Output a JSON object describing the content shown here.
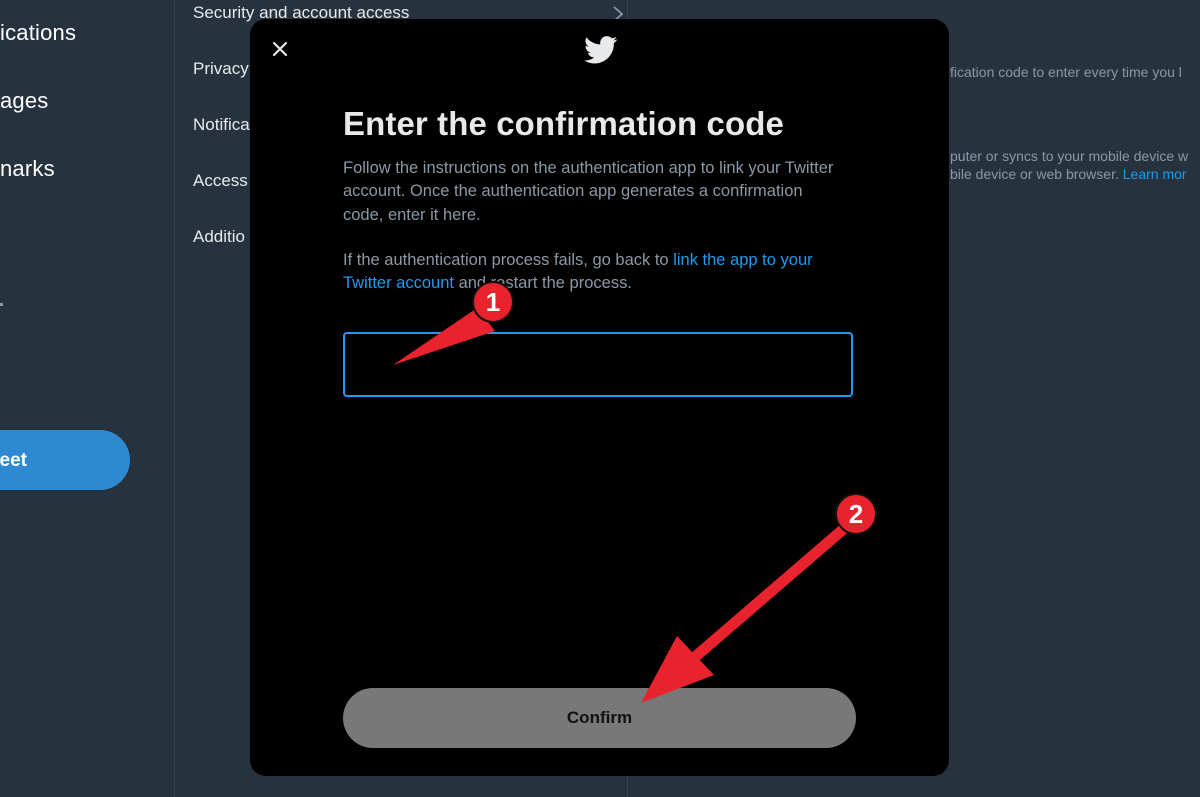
{
  "left_nav": {
    "items": [
      {
        "label": "ications"
      },
      {
        "label": "ages"
      },
      {
        "label": "narks"
      }
    ],
    "tweet_button": {
      "label": "eet"
    }
  },
  "settings": {
    "items": [
      {
        "label": "Security and account access"
      },
      {
        "label": "Privacy"
      },
      {
        "label": "Notifica"
      },
      {
        "label": "Access"
      },
      {
        "label": "Additio"
      }
    ]
  },
  "right_panel": {
    "line1": "fication code to enter every time you l",
    "line2": "puter or syncs to your mobile device w",
    "line3": "bile device or web browser.",
    "line3_link": "Learn mor"
  },
  "modal": {
    "title": "Enter the confirmation code",
    "description": "Follow the instructions on the authentication app to link your Twitter account. Once the authentication app generates a confirmation code, enter it here.",
    "help_prefix": "If the authentication process fails, go back to",
    "help_link": "link the app to your Twitter account",
    "help_suffix": "and restart the process.",
    "code_input": {
      "value": "",
      "placeholder": ""
    },
    "confirm_label": "Confirm"
  },
  "annotations": {
    "marker1": "1",
    "marker2": "2",
    "color": "#e8232e"
  },
  "colors": {
    "accent": "#1d9bf0",
    "background": "#27323f",
    "modal_bg": "#000000",
    "confirm_disabled": "#787878",
    "annotation": "#e8232e"
  },
  "icons": {
    "close": "close-icon",
    "logo": "twitter-bird-icon",
    "chevron": "chevron-right-icon"
  }
}
